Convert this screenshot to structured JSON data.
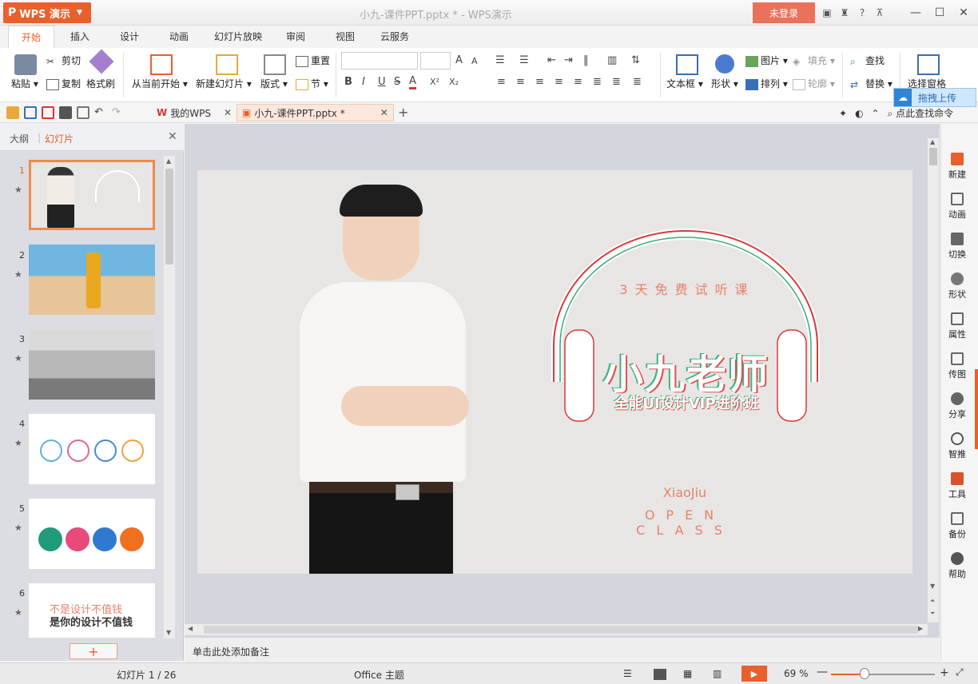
{
  "titlebar": {
    "app_label": "WPS 演示",
    "doc_title": "小九-课件PPT.pptx * - WPS演示",
    "login_label": "未登录",
    "icons": [
      "skin-icon",
      "shirt-icon",
      "help-icon",
      "collapse-icon"
    ],
    "help_label": "?"
  },
  "menu": {
    "tabs": [
      "开始",
      "插入",
      "设计",
      "动画",
      "幻灯片放映",
      "审阅",
      "视图",
      "云服务"
    ],
    "active": 0
  },
  "ribbon": {
    "paste": "粘贴",
    "cut": "剪切",
    "copy": "复制",
    "format_painter": "格式刷",
    "from_current": "从当前开始",
    "new_slide": "新建幻灯片",
    "layout": "版式",
    "reset": "重置",
    "section": "节",
    "textbox": "文本框",
    "shape": "形状",
    "picture": "图片",
    "fill": "填充",
    "arrange": "排列",
    "outline": "轮廓",
    "find": "查找",
    "replace": "替换",
    "selection_pane": "选择窗格",
    "font_buttons": [
      "B",
      "I",
      "U",
      "S",
      "A",
      "X²",
      "X₂"
    ],
    "grow": "A",
    "shrink": "A"
  },
  "quickbar": {
    "tabs": [
      {
        "label": "我的WPS"
      },
      {
        "label": "小九-课件PPT.pptx *"
      }
    ],
    "search_label": "点此查找命令",
    "cloud_tip": "拖拽上传"
  },
  "leftpanel": {
    "tab_outline": "大纲",
    "tab_slides": "幻灯片",
    "slides": [
      {
        "num": "1"
      },
      {
        "num": "2"
      },
      {
        "num": "3"
      },
      {
        "num": "4"
      },
      {
        "num": "5"
      },
      {
        "num": "6",
        "text1": "不是设计不值钱",
        "text2": "是你的设计不值钱"
      }
    ],
    "add_label": "+"
  },
  "slide": {
    "subtitle_top": "3天免费试听课",
    "title": "小九老师",
    "subtitle": "全能UI设计VIP进阶班",
    "name_en": "XiaoJiu",
    "class_en": "OPEN CLASS",
    "headphone_colors": {
      "outer": "#d93a3a",
      "inner": "#3aaa7a"
    }
  },
  "notes": {
    "placeholder": "单击此处添加备注"
  },
  "rightbar": {
    "items": [
      "新建",
      "动画",
      "切换",
      "形状",
      "属性",
      "传图",
      "分享",
      "智推",
      "工具",
      "备份",
      "帮助"
    ]
  },
  "status": {
    "slide_counter": "幻灯片 1 / 26",
    "theme": "Office 主题",
    "zoom": "69 %",
    "zoom_fraction": 0.32
  },
  "colors": {
    "accent": "#e8602c",
    "slide_bg": "#e7e6e4"
  }
}
